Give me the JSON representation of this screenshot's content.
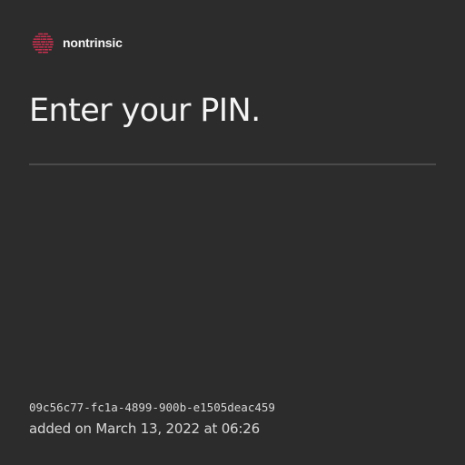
{
  "brand": {
    "name": "nontrinsic",
    "logo_icon": "nontrinsic-logo-icon",
    "accent_color": "#c7304f"
  },
  "main": {
    "title": "Enter your PIN."
  },
  "key": {
    "id": "09c56c77-fc1a-4899-900b-e1505deac459",
    "added": "added on March 13, 2022 at 06:26"
  },
  "colors": {
    "background": "#2c2c2c",
    "text": "#f4f4f4",
    "divider": "#4a4a4a"
  }
}
